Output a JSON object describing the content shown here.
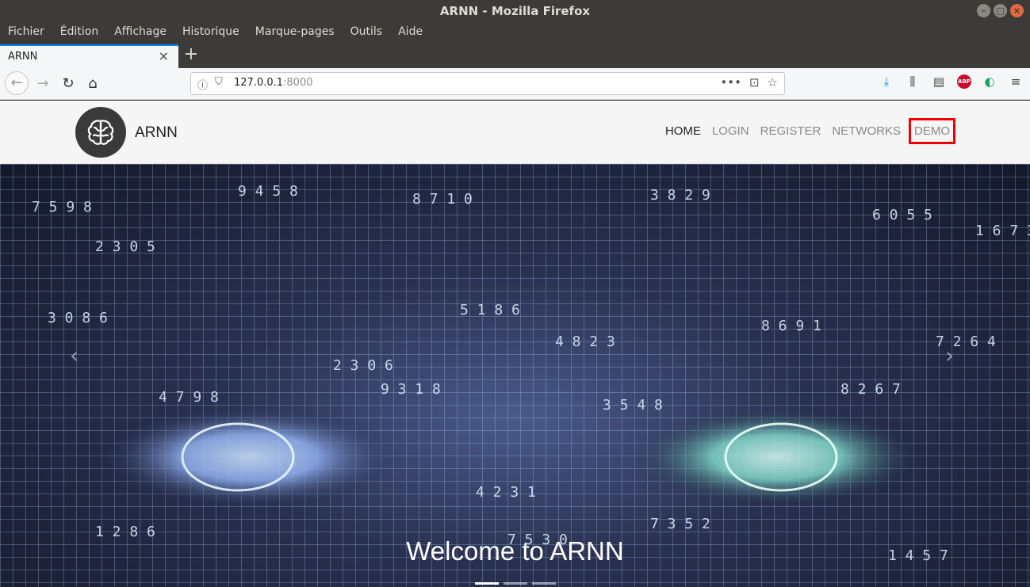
{
  "window": {
    "title": "ARNN - Mozilla Firefox"
  },
  "menu": {
    "items": [
      "Fichier",
      "Édition",
      "Affichage",
      "Historique",
      "Marque-pages",
      "Outils",
      "Aide"
    ]
  },
  "tab": {
    "title": "ARNN",
    "close": "×",
    "new": "+"
  },
  "url": {
    "host": "127.0.0.1",
    "port": ":8000"
  },
  "site": {
    "brand": "ARNN",
    "nav": [
      "HOME",
      "LOGIN",
      "REGISTER",
      "NETWORKS",
      "DEMO"
    ],
    "active_nav": "HOME",
    "highlighted_nav": "DEMO"
  },
  "hero": {
    "caption": "Welcome to ARNN",
    "slide_count": 3,
    "active_slide": 1,
    "prev": "‹",
    "next": "›"
  },
  "colors": {
    "highlight_box": "#ee0000",
    "firefox_accent": "#0a84ff"
  }
}
